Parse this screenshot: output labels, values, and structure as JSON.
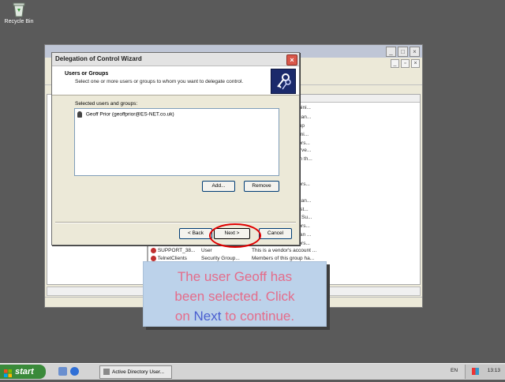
{
  "desktop": {
    "recycle_bin_label": "Recycle Bin"
  },
  "background_window": {
    "list_fragments": [
      "dmini...",
      "p can...",
      "roup",
      "ermi...",
      "ators...",
      "serve...",
      "s in th...",
      "ators...",
      "p can...",
      "uest...",
      "nd Su...",
      "ators...",
      "t can ...",
      "ators..."
    ],
    "rows": [
      {
        "name": "SUPPORT_38...",
        "type": "User",
        "description": "This is a vendor's account ..."
      },
      {
        "name": "TelnetClients",
        "type": "Security Group...",
        "description": "Members of this group ha..."
      }
    ]
  },
  "wizard": {
    "title": "Delegation of Control Wizard",
    "header_title": "Users or Groups",
    "header_subtitle": "Select one or more users or groups to whom you want to delegate control.",
    "selected_label": "Selected users and groups:",
    "selected_items": [
      "Geoff Prior (geoffprior@ES-NET.co.uk)"
    ],
    "add_button": "Add...",
    "remove_button": "Remove",
    "back_button": "< Back",
    "next_button": "Next >",
    "cancel_button": "Cancel"
  },
  "callout": {
    "line1": "The user Geoff has",
    "line2": "been selected. Click",
    "line3_pre": "on ",
    "line3_highlight": "Next",
    "line3_post": " to continue."
  },
  "taskbar": {
    "start_label": "start",
    "task_item": "Active Directory User...",
    "language": "EN",
    "clock": "13:13"
  },
  "colors": {
    "callout_text": "#e46c8a",
    "callout_highlight": "#4a5fd0",
    "highlight_ring": "#e00000"
  }
}
